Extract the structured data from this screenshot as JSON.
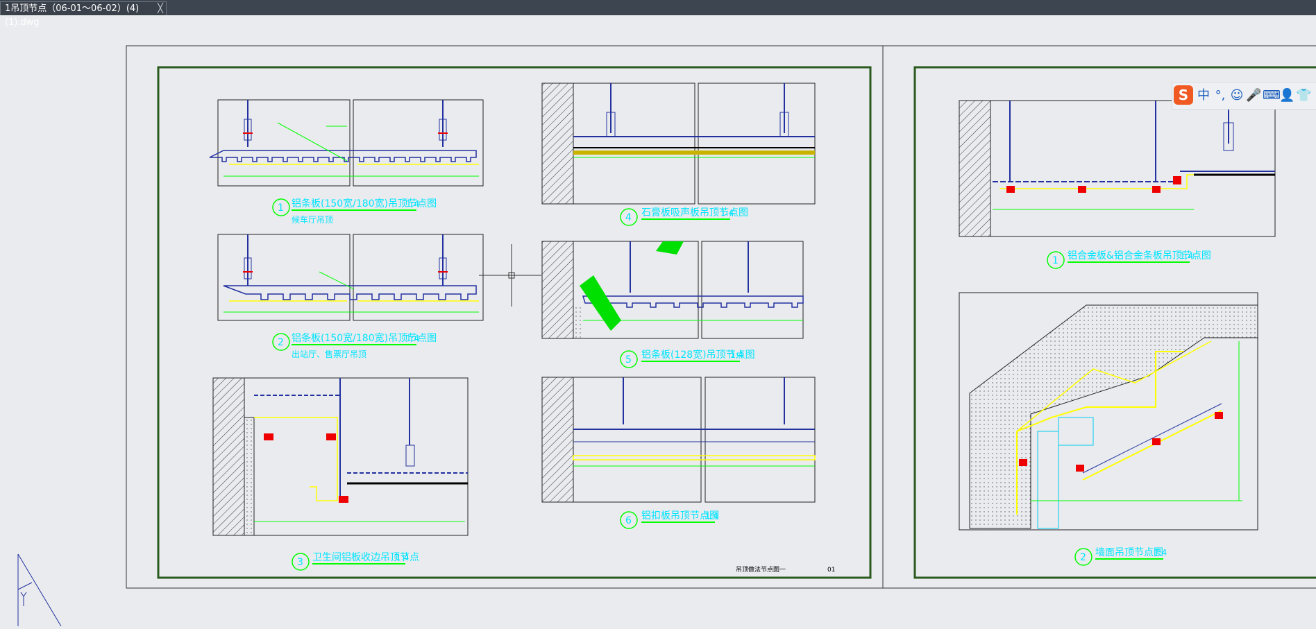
{
  "tab": {
    "title": "1吊顶节点（06-01～06-02）(4)(1).dwg",
    "close": "╳"
  },
  "ime": {
    "logo": "S",
    "items": [
      "中",
      "°,",
      "☺",
      "🎤",
      "⌨",
      "👤",
      "👕"
    ]
  },
  "sheet1": {
    "details": [
      {
        "num": "1",
        "title": "铝条板(150宽/180宽)吊顶节点图",
        "scale": "1:4",
        "sub": "候车厅吊顶"
      },
      {
        "num": "2",
        "title": "铝条板(150宽/180宽)吊顶节点图",
        "scale": "1:4",
        "sub": "出站厅、售票厅吊顶"
      },
      {
        "num": "3",
        "title": "卫生间铝板收边吊顶节点",
        "scale": "1:4",
        "sub": ""
      },
      {
        "num": "4",
        "title": "石膏板吸声板吊顶节点图",
        "scale": "1:4",
        "sub": ""
      },
      {
        "num": "5",
        "title": "铝条板(128宽)吊顶节点图",
        "scale": "1:4",
        "sub": ""
      },
      {
        "num": "6",
        "title": "铝扣板吊顶节点图",
        "scale": "1:4",
        "sub": ""
      }
    ],
    "footer_title": "吊顶做法节点图一",
    "footer_code": "01"
  },
  "sheet2": {
    "details": [
      {
        "num": "1",
        "title": "铝合金板&铝合金条板吊顶节点图",
        "scale": "1:4"
      },
      {
        "num": "2",
        "title": "墙面吊顶节点图",
        "scale": "1:4"
      }
    ]
  },
  "colors": {
    "tab_bg": "#3a414a",
    "canvas_bg": "#e9ebee",
    "cyan": "#00e5ff",
    "green": "#00ff00",
    "yellow": "#ffff00",
    "blue": "#1f2b9c"
  }
}
